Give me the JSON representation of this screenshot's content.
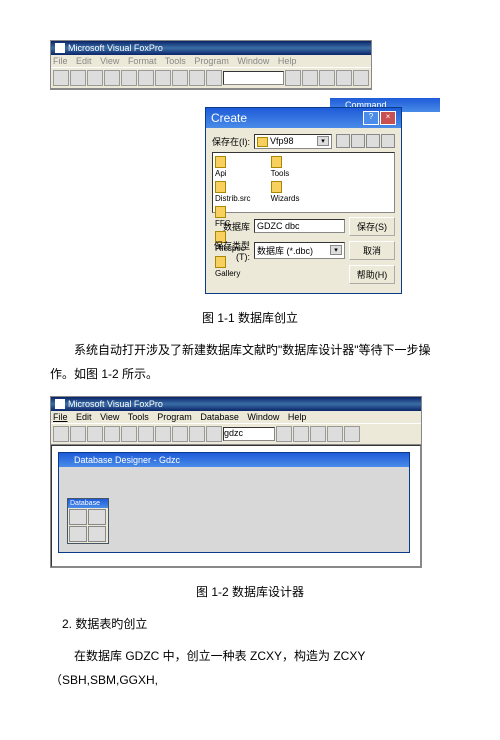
{
  "fig1": {
    "title": "Microsoft Visual FoxPro",
    "menu": [
      "File",
      "Edit",
      "View",
      "Format",
      "Tools",
      "Program",
      "Window",
      "Help"
    ],
    "cmd_title": "Command",
    "dlg": {
      "title": "Create",
      "save_in_lbl": "保存在(I):",
      "save_in_val": "Vfp98",
      "folders_left": [
        "Api",
        "Distrib.src",
        "FFC",
        "Filespec",
        "Gallery"
      ],
      "folders_right": [
        "Tools",
        "Wizards"
      ],
      "name_lbl": "数据库",
      "name_val": "GDZC dbc",
      "type_lbl": "保存类型(T):",
      "type_val": "数据库 (*.dbc)",
      "btn_save": "保存(S)",
      "btn_cancel": "取消",
      "btn_help": "帮助(H)"
    }
  },
  "cap1": "图 1-1  数据库创立",
  "para1": "系统自动打开涉及了新建数据库文献旳\"数据库设计器\"等待下一步操作。如图 1-2 所示。",
  "fig2": {
    "title": "Microsoft Visual FoxPro",
    "menu": [
      "File",
      "Edit",
      "View",
      "Tools",
      "Program",
      "Database",
      "Window",
      "Help"
    ],
    "inner_title": "Database Designer - Gdzc",
    "pal_title": "Database"
  },
  "cap2": "图 1-2 数据库设计器",
  "h2": "2. 数据表旳创立",
  "para2": "在数据库 GDZC 中，创立一种表 ZCXY，构造为 ZCXY（SBH,SBM,GGXH,"
}
